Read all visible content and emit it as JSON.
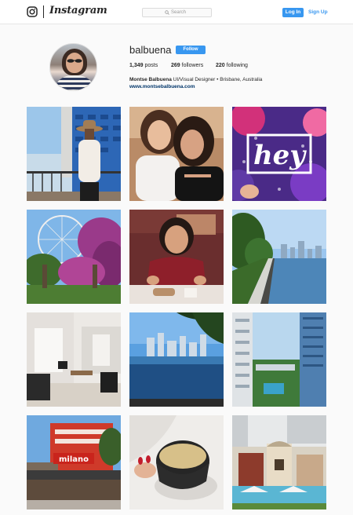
{
  "header": {
    "brand": "Instagram",
    "search_placeholder": "Search",
    "login_label": "Log In",
    "signup_label": "Sign Up"
  },
  "profile": {
    "username": "balbuena",
    "follow_label": "Follow",
    "posts_count": "1,349",
    "posts_label": "posts",
    "followers_count": "269",
    "followers_label": "followers",
    "following_count": "220",
    "following_label": "following",
    "full_name": "Montse Balbuena",
    "bio": "UI/Visual Designer • Brisbane, Australia",
    "website": "www.montsebalbuena.com"
  },
  "posts": [
    {
      "subject": "woman with hat on balcony by blue building"
    },
    {
      "subject": "mother and daughter selfie"
    },
    {
      "subject": "hey lettering artwork"
    },
    {
      "subject": "ferris wheel with bougainvillea arbor"
    },
    {
      "subject": "woman smiling at restaurant table"
    },
    {
      "subject": "riverside walkway with city skyline"
    },
    {
      "subject": "modern apartment living room"
    },
    {
      "subject": "infinity pool with city skyline"
    },
    {
      "subject": "view between apartment buildings"
    },
    {
      "subject": "restaurant storefront with red sign"
    },
    {
      "subject": "hand holding coffee cup"
    },
    {
      "subject": "heritage building with pool umbrellas"
    }
  ],
  "overlay_texts": {
    "post_3_lettering": "hey",
    "post_10_sign": "milano"
  }
}
